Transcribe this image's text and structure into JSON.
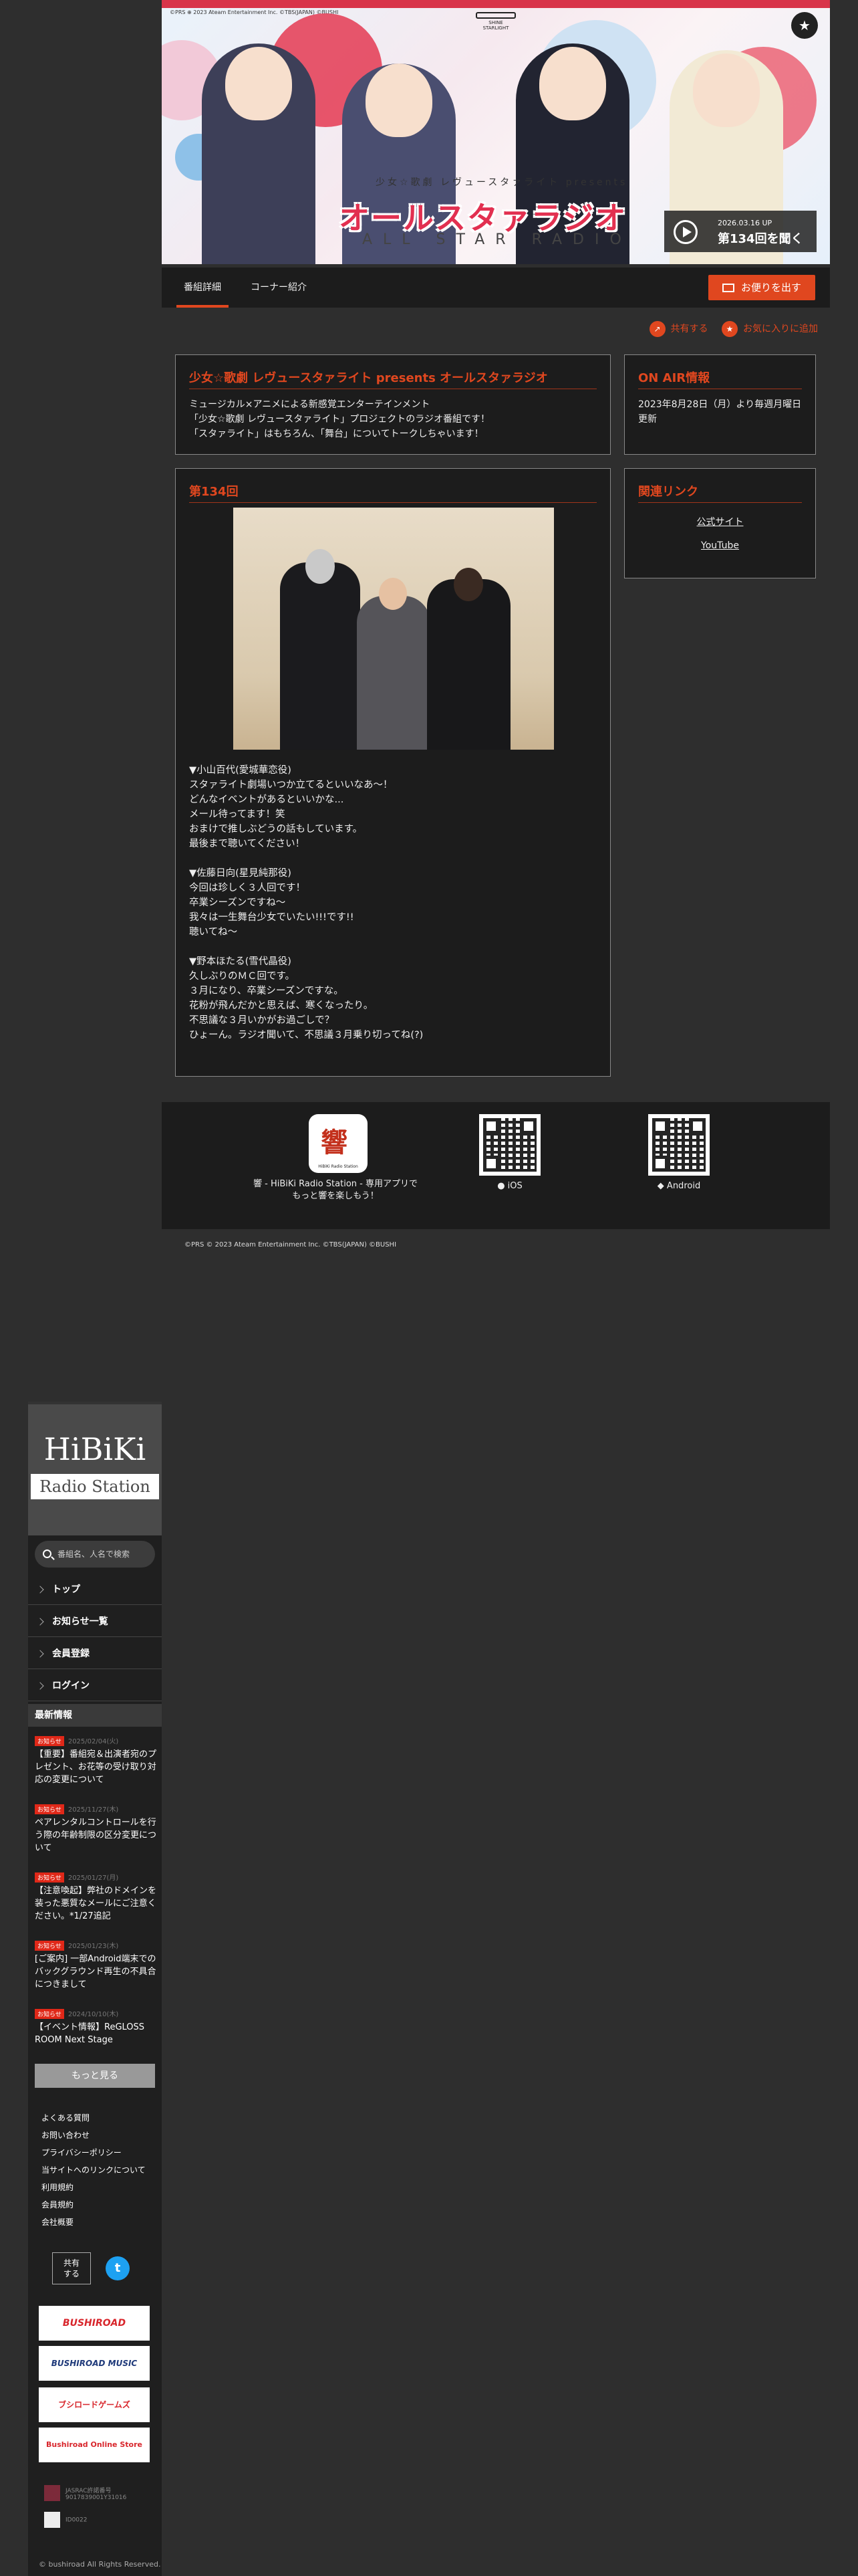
{
  "hero": {
    "copyright": "©PRS ⊕ 2023 Ateam Entertainment Inc. ©TBS(JAPAN) ©BUSHI",
    "subtitle": "少女☆歌劇 レヴュースタァライト presents",
    "title": "オールスタァラジオ",
    "title_en": "ALL STAR RADIO",
    "latest_date": "2026.03.16 UP",
    "latest_cta": "第134回を聞く",
    "corner_logo": "SHINE STARLIGHT"
  },
  "tabs": [
    "番組詳細",
    "コーナー紹介"
  ],
  "mail_button": "お便りを出す",
  "actions": {
    "share": "共有する",
    "favorite": "お気に入りに追加"
  },
  "program": {
    "heading": "少女☆歌劇 レヴュースタァライト presents オールスタァラジオ",
    "description": "ミュージカル×アニメによる新感覚エンターテインメント\n「少女☆歌劇 レヴュースタァライト」プロジェクトのラジオ番組です！\n「スタァライト」はもちろん、「舞台」についてトークしちゃいます！"
  },
  "onair": {
    "heading": "ON AIR情報",
    "text": "2023年8月28日（月）より毎週月曜日更新"
  },
  "episode": {
    "heading": "第134回",
    "body": "▼小山百代(愛城華恋役)\nスタァライト劇場いつか立てるといいなあ〜！\nどんなイベントがあるといいかな...\nメール待ってます！笑\nおまけで推しぶどうの話もしています。\n最後まで聴いてください！\n\n▼佐藤日向(星見純那役)\n今回は珍しく３人回です！\n卒業シーズンですね〜\n我々は一生舞台少女でいたい!!!です!!\n聴いてね〜\n\n▼野本ほたる(雪代晶役)\n久しぶりのＭＣ回です。\n３月になり、卒業シーズンですな。\n花粉が飛んだかと思えば、寒くなったり。\n不思議な３月いかがお過ごしで？\nひょーん。ラジオ聞いて、不思議３月乗り切ってね(?)"
  },
  "related": {
    "heading": "関連リンク",
    "links": [
      "公式サイト",
      "YouTube"
    ]
  },
  "app": {
    "icon_label": "HiBiKi Radio Station",
    "caption": "響 - HiBiKi Radio Station - 専用アプリで\nもっと響を楽しもう！",
    "ios": " iOS",
    "android": " Android"
  },
  "footnote": "©PRS © 2023 Ateam Entertainment Inc. ©TBS(JAPAN) ©BUSHI",
  "sidebar": {
    "logo_top": "HiBiKi",
    "logo_bottom": "Radio Station",
    "search_placeholder": "番組名、人名で検索",
    "nav": [
      "トップ",
      "お知らせ一覧",
      "会員登録",
      "ログイン"
    ],
    "news_heading": "最新情報",
    "news": [
      {
        "tag": "お知らせ",
        "date": "2025/02/04(火)",
        "title": "【重要】番組宛＆出演者宛のプレゼント、お花等の受け取り対応の変更について"
      },
      {
        "tag": "お知らせ",
        "date": "2025/11/27(木)",
        "title": "ペアレンタルコントロールを行う際の年齢制限の区分変更について"
      },
      {
        "tag": "お知らせ",
        "date": "2025/01/27(月)",
        "title": "【注意喚起】弊社のドメインを装った悪質なメールにご注意ください。*1/27追記"
      },
      {
        "tag": "お知らせ",
        "date": "2025/01/23(木)",
        "title": "[ご案内] 一部Android端末でのバックグラウンド再生の不具合につきまして"
      },
      {
        "tag": "お知らせ",
        "date": "2024/10/10(木)",
        "title": "【イベント情報】ReGLOSS ROOM Next Stage"
      }
    ],
    "more": "もっと見る",
    "links": [
      "よくある質問",
      "お問い合わせ",
      "プライバシーポリシー",
      "当サイトへのリンクについて",
      "利用規約",
      "会員規約",
      "会社概要"
    ],
    "share": "共有\nする",
    "sponsors": [
      "BUSHIROAD",
      "BUSHIROAD MUSIC",
      "ブシロードゲームズ",
      "Bushiroad Online Store"
    ],
    "jasrac": "JASRAC許諾番号\n9017839001Y31016",
    "nextone": "ID0022",
    "copyright": "© bushiroad All Rights Reserved."
  },
  "colors": {
    "accent": "#e0471f",
    "panel": "#1c1c1c",
    "background": "#2e2e2e"
  }
}
